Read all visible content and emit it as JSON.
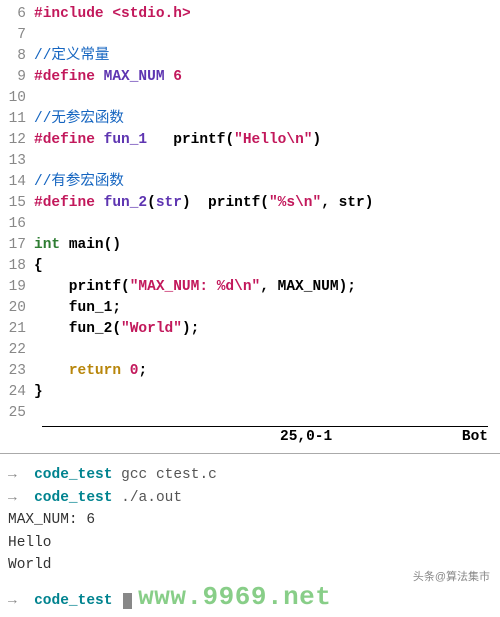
{
  "editor": {
    "lines": [
      {
        "n": "6",
        "tokens": [
          [
            "tok-preproc",
            "#include "
          ],
          [
            "tok-header",
            "<stdio.h>"
          ]
        ]
      },
      {
        "n": "7",
        "tokens": []
      },
      {
        "n": "8",
        "tokens": [
          [
            "tok-comment",
            "//定义常量"
          ]
        ]
      },
      {
        "n": "9",
        "tokens": [
          [
            "tok-preproc",
            "#define "
          ],
          [
            "tok-macroname",
            "MAX_NUM"
          ],
          [
            "tok-plain",
            " "
          ],
          [
            "tok-num",
            "6"
          ]
        ]
      },
      {
        "n": "10",
        "tokens": []
      },
      {
        "n": "11",
        "tokens": [
          [
            "tok-comment",
            "//无参宏函数"
          ]
        ]
      },
      {
        "n": "12",
        "tokens": [
          [
            "tok-preproc",
            "#define "
          ],
          [
            "tok-macroname",
            "fun_1"
          ],
          [
            "tok-plain",
            "   printf("
          ],
          [
            "tok-str",
            "\"Hello\\n\""
          ],
          [
            "tok-plain",
            ")"
          ]
        ]
      },
      {
        "n": "13",
        "tokens": []
      },
      {
        "n": "14",
        "tokens": [
          [
            "tok-comment",
            "//有参宏函数"
          ]
        ]
      },
      {
        "n": "15",
        "tokens": [
          [
            "tok-preproc",
            "#define "
          ],
          [
            "tok-macroname",
            "fun_2"
          ],
          [
            "tok-plain",
            "("
          ],
          [
            "tok-macroname",
            "str"
          ],
          [
            "tok-plain",
            ")  printf("
          ],
          [
            "tok-str",
            "\"%s\\n\""
          ],
          [
            "tok-plain",
            ", str)"
          ]
        ]
      },
      {
        "n": "16",
        "tokens": []
      },
      {
        "n": "17",
        "tokens": [
          [
            "tok-type",
            "int"
          ],
          [
            "tok-plain",
            " "
          ],
          [
            "tok-fn",
            "main"
          ],
          [
            "tok-plain",
            "()"
          ]
        ]
      },
      {
        "n": "18",
        "tokens": [
          [
            "tok-plain",
            "{"
          ]
        ]
      },
      {
        "n": "19",
        "tokens": [
          [
            "tok-plain",
            "    printf("
          ],
          [
            "tok-str",
            "\"MAX_NUM: %d\\n\""
          ],
          [
            "tok-plain",
            ", MAX_NUM);"
          ]
        ]
      },
      {
        "n": "20",
        "tokens": [
          [
            "tok-plain",
            "    fun_1;"
          ]
        ]
      },
      {
        "n": "21",
        "tokens": [
          [
            "tok-plain",
            "    fun_2("
          ],
          [
            "tok-str",
            "\"World\""
          ],
          [
            "tok-plain",
            ");"
          ]
        ]
      },
      {
        "n": "22",
        "tokens": []
      },
      {
        "n": "23",
        "tokens": [
          [
            "tok-plain",
            "    "
          ],
          [
            "tok-kw",
            "return"
          ],
          [
            "tok-plain",
            " "
          ],
          [
            "tok-num",
            "0"
          ],
          [
            "tok-plain",
            ";"
          ]
        ]
      },
      {
        "n": "24",
        "tokens": [
          [
            "tok-plain",
            "}"
          ]
        ]
      },
      {
        "n": "25",
        "tokens": []
      }
    ]
  },
  "status": {
    "position": "25,0-1",
    "mode": "Bot"
  },
  "terminal": {
    "prompt_arrow": "→",
    "dir": "code_test",
    "lines": [
      {
        "type": "cmd",
        "text": "gcc ctest.c"
      },
      {
        "type": "cmd",
        "text": "./a.out"
      },
      {
        "type": "out",
        "text": "MAX_NUM: 6"
      },
      {
        "type": "out",
        "text": "Hello"
      },
      {
        "type": "out",
        "text": "World"
      },
      {
        "type": "cmd-cursor",
        "text": ""
      }
    ]
  },
  "watermark": "www.9969.net",
  "credit": "头条@算法集市"
}
